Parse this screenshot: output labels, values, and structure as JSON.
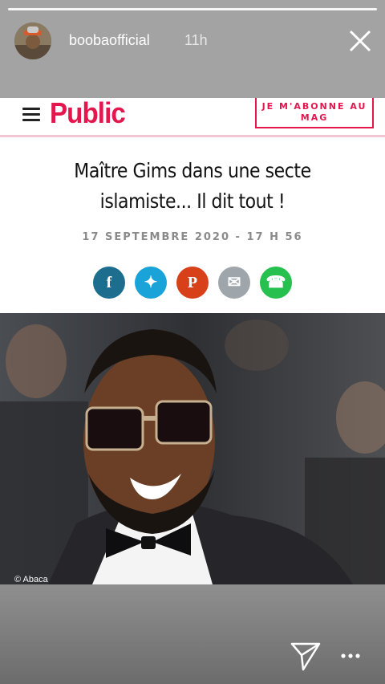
{
  "story": {
    "username": "boobaofficial",
    "time": "11h",
    "progress": 1.0
  },
  "article": {
    "brand": "Public",
    "subscribe_label": "JE M'ABONNE AU MAG",
    "title": "Maître Gims dans une secte islamiste... Il dit tout !",
    "date": "17 SEPTEMBRE 2020 - 17 H 56",
    "share_buttons": [
      {
        "name": "facebook",
        "glyph": "f",
        "color": "#1d6d8f"
      },
      {
        "name": "twitter",
        "glyph": "✦",
        "color": "#1aa3d9"
      },
      {
        "name": "pinterest",
        "glyph": "P",
        "color": "#d8401a"
      },
      {
        "name": "email",
        "glyph": "✉",
        "color": "#9ea5ab"
      },
      {
        "name": "whatsapp",
        "glyph": "☎",
        "color": "#26c04f"
      }
    ],
    "photo_credit": "© Abaca"
  },
  "colors": {
    "brand": "#e3164e"
  }
}
